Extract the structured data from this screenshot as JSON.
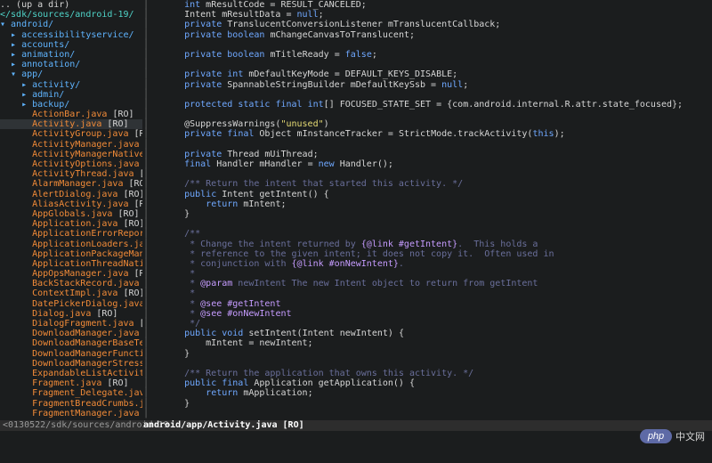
{
  "sidebar": {
    "lines": [
      {
        "text": ".. (up a dir)",
        "cls": "hdr"
      },
      {
        "text": "</sdk/sources/android-19/",
        "cls": "root"
      },
      {
        "text": "▾ android/",
        "cls": "dir"
      },
      {
        "text": "  ▸ accessibilityservice/",
        "cls": "dir"
      },
      {
        "text": "  ▸ accounts/",
        "cls": "dir"
      },
      {
        "text": "  ▸ animation/",
        "cls": "dir"
      },
      {
        "text": "  ▸ annotation/",
        "cls": "dir"
      },
      {
        "text": "  ▾ app/",
        "cls": "dir"
      },
      {
        "text": "    ▸ activity/",
        "cls": "dir"
      },
      {
        "text": "    ▸ admin/",
        "cls": "dir"
      },
      {
        "text": "    ▸ backup/",
        "cls": "dir"
      },
      {
        "text": "      ActionBar.java [RO]",
        "cls": "file"
      },
      {
        "text": "      Activity.java [RO]",
        "cls": "file sel"
      },
      {
        "text": "      ActivityGroup.java [RO]",
        "cls": "file"
      },
      {
        "text": "      ActivityManager.java [RO]",
        "cls": "file"
      },
      {
        "text": "      ActivityManagerNative.jav",
        "cls": "file"
      },
      {
        "text": "      ActivityOptions.java [RO]",
        "cls": "file"
      },
      {
        "text": "      ActivityThread.java [RO]",
        "cls": "file"
      },
      {
        "text": "      AlarmManager.java [RO]",
        "cls": "file"
      },
      {
        "text": "      AlertDialog.java [RO]",
        "cls": "file"
      },
      {
        "text": "      AliasActivity.java [RO]",
        "cls": "file"
      },
      {
        "text": "      AppGlobals.java [RO]",
        "cls": "file"
      },
      {
        "text": "      Application.java [RO]",
        "cls": "file"
      },
      {
        "text": "      ApplicationErrorReport.ja",
        "cls": "file"
      },
      {
        "text": "      ApplicationLoaders.java [",
        "cls": "file"
      },
      {
        "text": "      ApplicationPackageManager",
        "cls": "file"
      },
      {
        "text": "      ApplicationThreadNative.j",
        "cls": "file"
      },
      {
        "text": "      AppOpsManager.java [RO]",
        "cls": "file"
      },
      {
        "text": "      BackStackRecord.java [RO]",
        "cls": "file"
      },
      {
        "text": "      ContextImpl.java [RO]",
        "cls": "file"
      },
      {
        "text": "      DatePickerDialog.java [RO",
        "cls": "file"
      },
      {
        "text": "      Dialog.java [RO]",
        "cls": "file"
      },
      {
        "text": "      DialogFragment.java [RO]",
        "cls": "file"
      },
      {
        "text": "      DownloadManager.java [RO]",
        "cls": "file"
      },
      {
        "text": "      DownloadManagerBaseTest.j",
        "cls": "file"
      },
      {
        "text": "      DownloadManagerFunctional",
        "cls": "file"
      },
      {
        "text": "      DownloadManagerStressTest",
        "cls": "file"
      },
      {
        "text": "      ExpandableListActivity.ja",
        "cls": "file"
      },
      {
        "text": "      Fragment.java [RO]",
        "cls": "file"
      },
      {
        "text": "      Fragment_Delegate.java [R",
        "cls": "file"
      },
      {
        "text": "      FragmentBreadCrumbs.java",
        "cls": "file"
      },
      {
        "text": "      FragmentManager.java [RO]",
        "cls": "file"
      }
    ]
  },
  "code": {
    "lines": [
      "    int mResultCode = RESULT_CANCELED;",
      "    Intent mResultData = null;",
      "    private TranslucentConversionListener mTranslucentCallback;",
      "    private boolean mChangeCanvasToTranslucent;",
      "",
      "    private boolean mTitleReady = false;",
      "",
      "    private int mDefaultKeyMode = DEFAULT_KEYS_DISABLE;",
      "    private SpannableStringBuilder mDefaultKeySsb = null;",
      "",
      "    protected static final int[] FOCUSED_STATE_SET = {com.android.internal.R.attr.state_focused};",
      "",
      "    @SuppressWarnings(\"unused\")",
      "    private final Object mInstanceTracker = StrictMode.trackActivity(this);",
      "",
      "    private Thread mUiThread;",
      "    final Handler mHandler = new Handler();",
      "",
      "    /** Return the intent that started this activity. */",
      "    public Intent getIntent() {",
      "        return mIntent;",
      "    }",
      "",
      "    /**",
      "     * Change the intent returned by {@link #getIntent}.  This holds a",
      "     * reference to the given intent; it does not copy it.  Often used in",
      "     * conjunction with {@link #onNewIntent}.",
      "     *",
      "     * @param newIntent The new Intent object to return from getIntent",
      "     *",
      "     * @see #getIntent",
      "     * @see #onNewIntent",
      "     */",
      "    public void setIntent(Intent newIntent) {",
      "        mIntent = newIntent;",
      "    }",
      "",
      "    /** Return the application that owns this activity. */",
      "    public final Application getApplication() {",
      "        return mApplication;",
      "    }",
      "",
      ""
    ]
  },
  "status": {
    "left": "<0130522/sdk/sources/android-19",
    "right": "android/app/Activity.java [RO]"
  },
  "watermark": {
    "logo": "php",
    "text": "中文网"
  }
}
